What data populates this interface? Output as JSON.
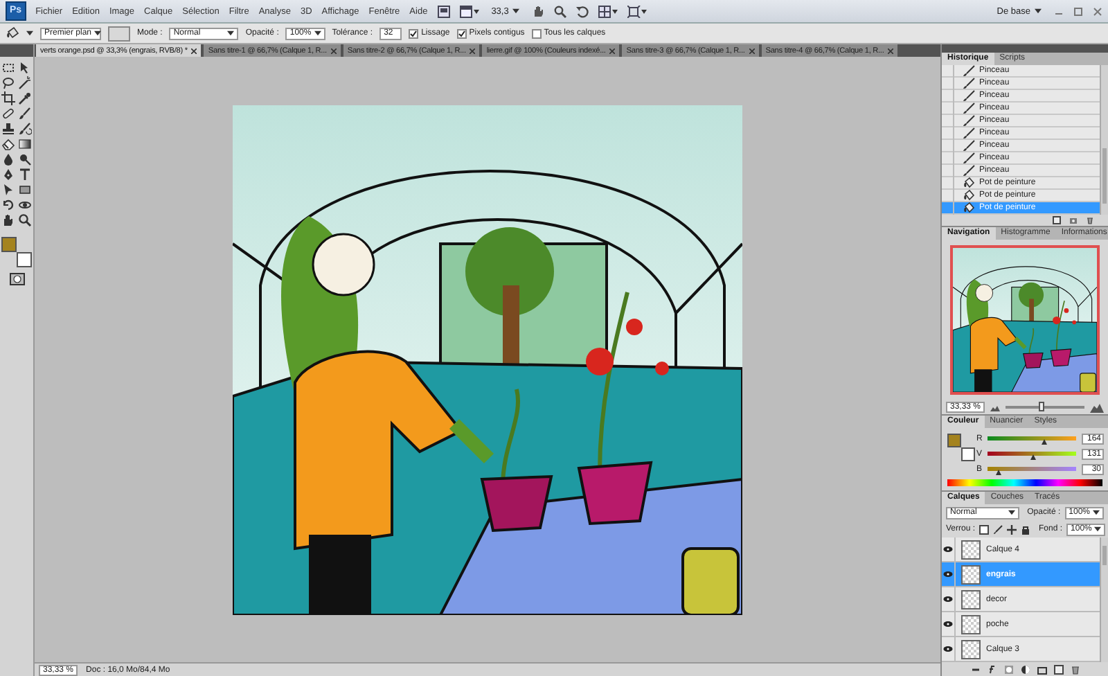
{
  "menu_bar": {
    "logo": "Ps",
    "items": [
      "Fichier",
      "Edition",
      "Image",
      "Calque",
      "Sélection",
      "Filtre",
      "Analyse",
      "3D",
      "Affichage",
      "Fenêtre",
      "Aide"
    ],
    "zoom": "33,3",
    "workspace": "De base"
  },
  "options_bar": {
    "preset": "Premier plan",
    "mode_label": "Mode :",
    "mode": "Normal",
    "opacity_label": "Opacité :",
    "opacity": "100%",
    "tolerance_label": "Tolérance :",
    "tolerance": "32",
    "checkboxes": [
      {
        "label": "Lissage",
        "checked": true
      },
      {
        "label": "Pixels contigus",
        "checked": true
      },
      {
        "label": "Tous les calques",
        "checked": false
      }
    ]
  },
  "document_tabs": [
    {
      "label": "verts orange.psd @ 33,3% (engrais, RVB/8) *",
      "selected": true
    },
    {
      "label": "Sans titre-1 @ 66,7% (Calque 1, R...",
      "selected": false
    },
    {
      "label": "Sans titre-2 @ 66,7% (Calque 1, R...",
      "selected": false
    },
    {
      "label": "lierre.gif @ 100% (Couleurs indexé...",
      "selected": false
    },
    {
      "label": "Sans titre-3 @ 66,7% (Calque 1, R...",
      "selected": false
    },
    {
      "label": "Sans titre-4 @ 66,7% (Calque 1, R...",
      "selected": false
    }
  ],
  "color_swatches": [
    {
      "kind": "foreground",
      "color": "#a4831e"
    },
    {
      "kind": "background",
      "color": "#ffffff"
    }
  ],
  "history_panel": {
    "tabs": [
      {
        "label": "Historique",
        "selected": true
      },
      {
        "label": "Scripts",
        "selected": false
      }
    ],
    "items": [
      {
        "label": "Pinceau",
        "kind": "brush",
        "selected": false
      },
      {
        "label": "Pinceau",
        "kind": "brush",
        "selected": false
      },
      {
        "label": "Pinceau",
        "kind": "brush",
        "selected": false
      },
      {
        "label": "Pinceau",
        "kind": "brush",
        "selected": false
      },
      {
        "label": "Pinceau",
        "kind": "brush",
        "selected": false
      },
      {
        "label": "Pinceau",
        "kind": "brush",
        "selected": false
      },
      {
        "label": "Pinceau",
        "kind": "brush",
        "selected": false
      },
      {
        "label": "Pinceau",
        "kind": "brush",
        "selected": false
      },
      {
        "label": "Pinceau",
        "kind": "brush",
        "selected": false
      },
      {
        "label": "Pot de peinture",
        "kind": "bucket",
        "selected": false
      },
      {
        "label": "Pot de peinture",
        "kind": "bucket",
        "selected": false
      },
      {
        "label": "Pot de peinture",
        "kind": "bucket",
        "selected": true
      }
    ]
  },
  "navigator_panel": {
    "tabs": [
      {
        "label": "Navigation",
        "selected": true
      },
      {
        "label": "Histogramme",
        "selected": false
      },
      {
        "label": "Informations",
        "selected": false
      }
    ],
    "zoom": "33,33 %",
    "level": 0.45
  },
  "color_panel": {
    "tabs": [
      {
        "label": "Couleur",
        "selected": true
      },
      {
        "label": "Nuancier",
        "selected": false
      },
      {
        "label": "Styles",
        "selected": false
      }
    ],
    "channels": [
      {
        "label": "R",
        "value": "164",
        "level": 0.64
      },
      {
        "label": "V",
        "value": "131",
        "level": 0.51
      },
      {
        "label": "B",
        "value": "30",
        "level": 0.12
      }
    ]
  },
  "layers_panel": {
    "tabs": [
      {
        "label": "Calques",
        "selected": true
      },
      {
        "label": "Couches",
        "selected": false
      },
      {
        "label": "Tracés",
        "selected": false
      }
    ],
    "blend_mode": "Normal",
    "opacity_label": "Opacité :",
    "opacity": "100%",
    "lock_label": "Verrou :",
    "fill_label": "Fond :",
    "fill": "100%",
    "layers": [
      {
        "name": "Calque 4",
        "visible": true,
        "selected": false
      },
      {
        "name": "engrais",
        "visible": true,
        "selected": true
      },
      {
        "name": "decor",
        "visible": true,
        "selected": false
      },
      {
        "name": "poche",
        "visible": true,
        "selected": false
      },
      {
        "name": "Calque 3",
        "visible": true,
        "selected": false
      }
    ]
  },
  "status_bar": {
    "zoom": "33,33 %",
    "document_size": "Doc : 16,0 Mo/84,4 Mo"
  }
}
